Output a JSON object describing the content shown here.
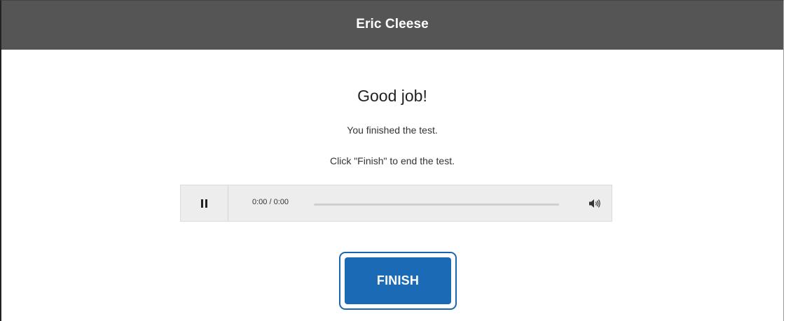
{
  "header": {
    "title": "Eric Cleese"
  },
  "content": {
    "heading": "Good job!",
    "message": "You finished the test.",
    "instruction": "Click \"Finish\" to end the test."
  },
  "audio_player": {
    "time_display": "0:00 / 0:00",
    "playback_progress": 0,
    "state": "playing",
    "pause_icon": "pause-icon",
    "volume_icon": "speaker-volume-icon"
  },
  "actions": {
    "finish_label": "FINISH"
  },
  "colors": {
    "header_bg": "#555555",
    "accent": "#1a6ab6",
    "player_bg": "#ededed"
  }
}
